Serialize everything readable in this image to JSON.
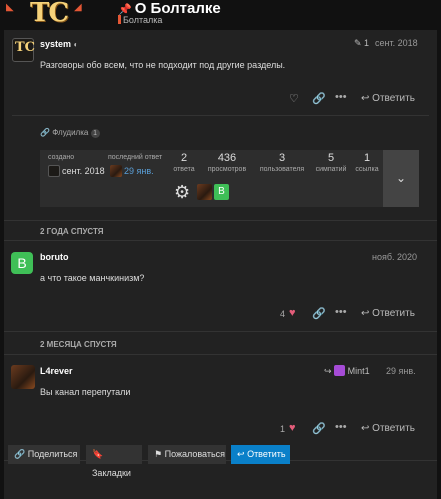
{
  "header": {
    "logo_text": "TC",
    "title": "О Болталке",
    "category": "Болталка"
  },
  "posts": [
    {
      "username": "system",
      "date": "сент. 2018",
      "body": "Разговоры обо всем, что не подходит под другие разделы.",
      "reply_label": "Ответить"
    },
    {
      "username": "boruto",
      "avatar_letter": "B",
      "date": "нояб. 2020",
      "body": "а что такое манчкинизм?",
      "likes": "4",
      "reply_label": "Ответить"
    },
    {
      "username": "L4rever",
      "reply_to": "Mint1",
      "date": "29 янв.",
      "body": "Вы канал перепутали",
      "likes": "1",
      "reply_label": "Ответить"
    }
  ],
  "edit_count": "1",
  "link": {
    "label": "Флудилка",
    "count": "1"
  },
  "summary": {
    "created_label": "создано",
    "created_date": "сент. 2018",
    "last_reply_label": "последний ответ",
    "last_reply_date": "29 янв.",
    "stats": [
      {
        "value": "2",
        "label": "ответа"
      },
      {
        "value": "436",
        "label": "просмотров"
      },
      {
        "value": "3",
        "label": "пользователя"
      },
      {
        "value": "5",
        "label": "симпатий"
      },
      {
        "value": "1",
        "label": "ссылка"
      }
    ],
    "participant_letter": "B"
  },
  "gaps": [
    "2 ГОДА СПУСТЯ",
    "2 МЕСЯЦА СПУСТЯ"
  ],
  "footer": {
    "share": "Поделиться",
    "bookmarks": "Закладки",
    "flag": "Пожаловаться",
    "reply": "Ответить"
  },
  "colors": {
    "accent": "#e45735",
    "primary": "#0a80c9",
    "like": "#e45d7a",
    "avatar_green": "#3fbf57"
  }
}
